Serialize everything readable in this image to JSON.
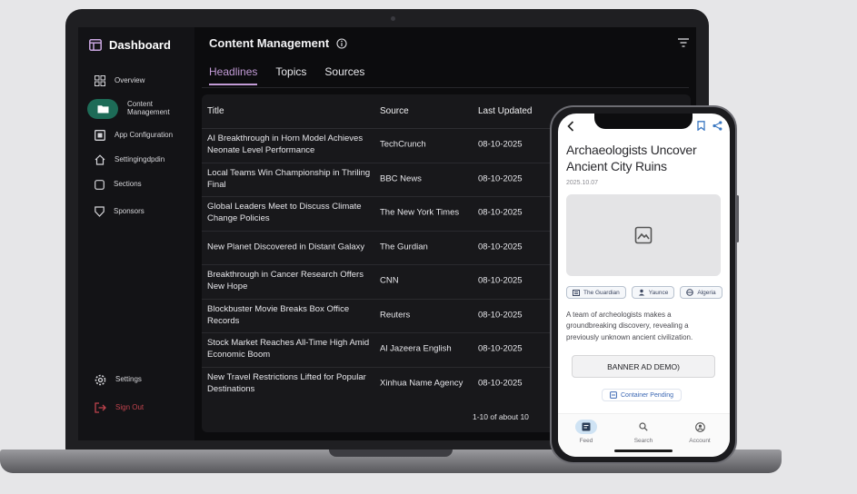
{
  "sidebar": {
    "brand": "Dashboard",
    "items": [
      {
        "label": "Overview",
        "icon": "grid-icon"
      },
      {
        "label": "Content Management",
        "icon": "folder-icon"
      },
      {
        "label": "App Configuration",
        "icon": "config-icon"
      },
      {
        "label": "Settingingdpdin",
        "icon": "home-icon"
      },
      {
        "label": "Sections",
        "icon": "square-icon"
      },
      {
        "label": "Sponsors",
        "icon": "shield-icon"
      }
    ],
    "settings": "Settings",
    "sign_out": "Sign Out"
  },
  "main": {
    "title": "Content Management",
    "tabs": [
      "Headlines",
      "Topics",
      "Sources"
    ],
    "active_tab": "Headlines",
    "columns": [
      "Title",
      "Source",
      "Last Updated"
    ],
    "rows": [
      {
        "title": "AI Breakthrough in Horn Model Achieves Neonate Level Performance",
        "source": "TechCrunch",
        "date": "08-10-2025"
      },
      {
        "title": "Local Teams Win Championship in Thriling Final",
        "source": "BBC News",
        "date": "08-10-2025"
      },
      {
        "title": "Global Leaders Meet to Discuss Climate Change Policies",
        "source": "The New York Times",
        "date": "08-10-2025"
      },
      {
        "title": "New Planet Discovered in Distant Galaxy",
        "source": "The Gurdian",
        "date": "08-10-2025"
      },
      {
        "title": "Breakthrough in Cancer Research Offers New Hope",
        "source": "CNN",
        "date": "08-10-2025"
      },
      {
        "title": "Blockbuster Movie Breaks Box Office Records",
        "source": "Reuters",
        "date": "08-10-2025"
      },
      {
        "title": "Stock Market Reaches All-Time High Amid Economic Boom",
        "source": "Al Jazeera English",
        "date": "08-10-2025"
      },
      {
        "title": "New Travel Restrictions Lifted for Popular Destinations",
        "source": "Xinhua Name Agency",
        "date": "08-10-2025"
      }
    ],
    "pagination": "1-10 of about 10"
  },
  "phone": {
    "headline": "Archaeologists Uncover Ancient City Ruins",
    "date": "2025.10.07",
    "chips": [
      "The Guardian",
      "Yaunce",
      "Algeria"
    ],
    "body": "A team of archeologists makes a groundbreaking discovery, revealing a previously unknown ancient civilization.",
    "ad": "BANNER AD DEMO)",
    "pending": "Container Pending",
    "nav": [
      "Feed",
      "Search",
      "Account"
    ]
  },
  "colors": {
    "accent": "#c29bd6",
    "active_pill": "#1d6b57",
    "sign_out": "#c0434d",
    "link": "#3b67b3"
  }
}
